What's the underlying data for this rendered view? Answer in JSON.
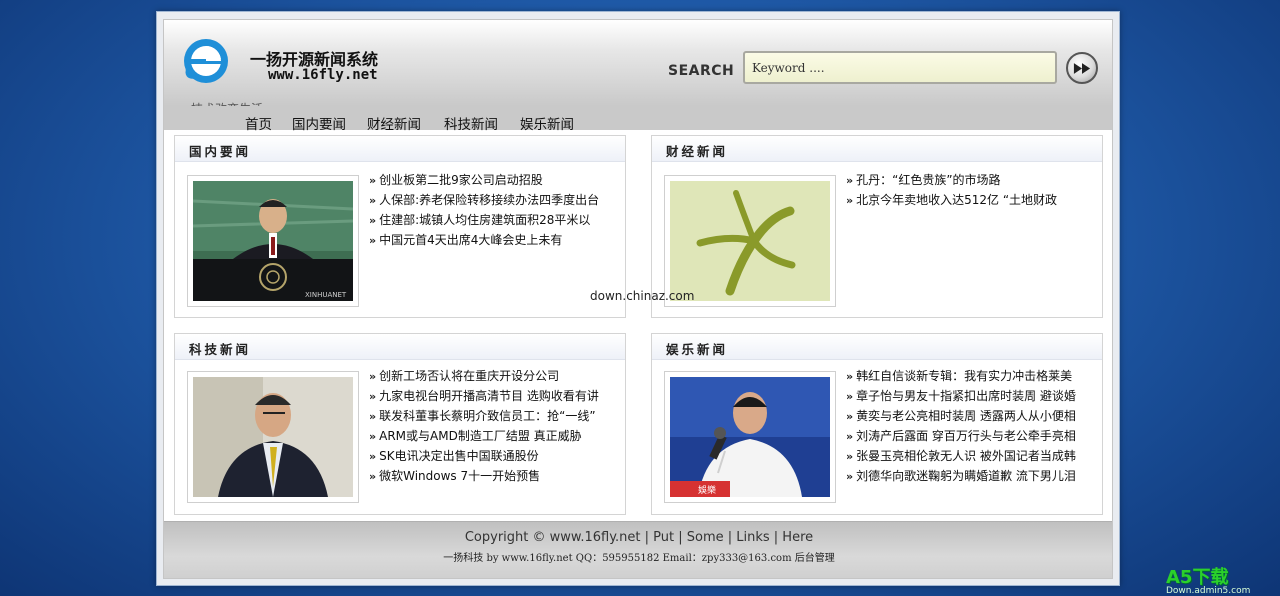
{
  "header": {
    "site_title": "一扬开源新闻系统",
    "site_url": "www.16fly.net",
    "slogan": "技术改变生活",
    "search_label": "SEARCH",
    "search_placeholder": "Keyword ....",
    "logo_icon": "ie-e-logo-icon",
    "go_icon": "fast-forward-icon"
  },
  "nav": [
    "首页",
    "国内要闻",
    "财经新闻",
    "科技新闻",
    "娱乐新闻"
  ],
  "panels": [
    {
      "title": "国内要闻",
      "image": "un-podium-speaker-photo",
      "image_caption": "XINHUANET",
      "items": [
        "创业板第二批9家公司启动招股",
        "人保部:养老保险转移接续办法四季度出台",
        "住建部:城镇人均住房建筑面积28平米以",
        "中国元首4天出席4大峰会史上未有"
      ]
    },
    {
      "title": "财经新闻",
      "image": "green-starfish-logo",
      "items": [
        "孔丹：“红色贵族”的市场路",
        "北京今年卖地收入达512亿 “土地财政"
      ]
    },
    {
      "title": "科技新闻",
      "image": "executive-portrait-photo",
      "items": [
        "创新工场否认将在重庆开设分公司",
        "九家电视台明开播高清节目 选购收看有讲",
        "联发科董事长蔡明介致信员工：抢“一线”",
        "ARM或与AMD制造工厂结盟 真正威胁",
        "SK电讯决定出售中国联通股份",
        "微软Windows 7十一开始预售"
      ]
    },
    {
      "title": "娱乐新闻",
      "image": "singer-with-microphone-photo",
      "image_caption": "娛樂",
      "items": [
        "韩红自信谈新专辑：我有实力冲击格莱美",
        "章子怡与男友十指紧扣出席时装周 避谈婚",
        "黄奕与老公亮相时装周 透露两人从小便相",
        "刘涛产后露面 穿百万行头与老公牵手亮相",
        "张曼玉亮相伦敦无人识 被外国记者当成韩",
        "刘德华向歌迷鞠躬为瞒婚道歉 流下男儿泪"
      ]
    }
  ],
  "footer": {
    "line1": "Copyright © www.16fly.net | Put | Some | Links | Here",
    "line2": "一扬科技 by www.16fly.net QQ：595955182  Email：zpy333@163.com  后台管理"
  },
  "watermark": "down.chinaz.com",
  "corner_badge": {
    "brand": "A5下载",
    "url": "Down.admin5.com"
  },
  "colors": {
    "bg_blue": "#1f5aa8",
    "header_gray": "#c9c9c9",
    "badge_green": "#2bd12b"
  }
}
